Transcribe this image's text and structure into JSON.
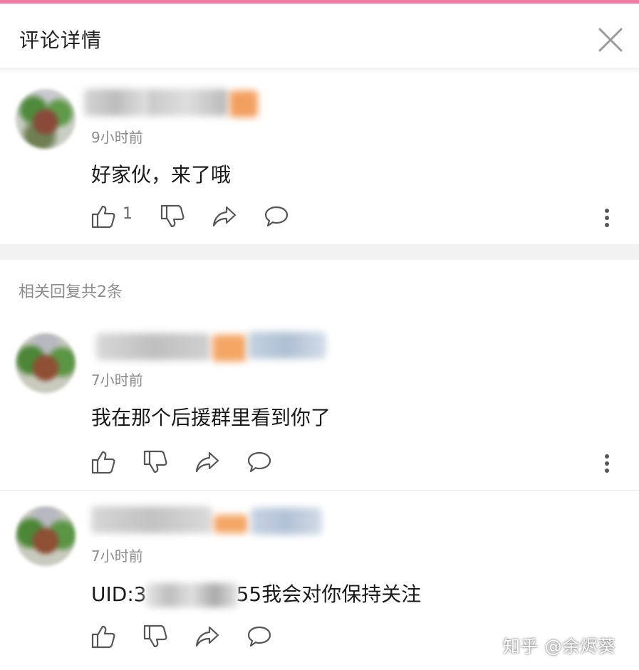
{
  "header": {
    "title": "评论详情"
  },
  "main_comment": {
    "time": "9小时前",
    "text": "好家伙，来了哦",
    "like_count": "1"
  },
  "replies_section": {
    "title": "相关回复共2条"
  },
  "replies": [
    {
      "time": "7小时前",
      "text": "我在那个后援群里看到你了"
    },
    {
      "time": "7小时前",
      "text_prefix": "UID:3",
      "text_suffix": "55我会对你保持关注"
    }
  ],
  "watermark": "知乎 @余烬葵",
  "colors": {
    "accent": "#f07aa0",
    "text_secondary": "#8c8c8c",
    "icon": "#555555"
  },
  "icons": [
    "close-icon",
    "thumbs-up-icon",
    "thumbs-down-icon",
    "share-icon",
    "comment-icon",
    "more-vertical-icon"
  ]
}
